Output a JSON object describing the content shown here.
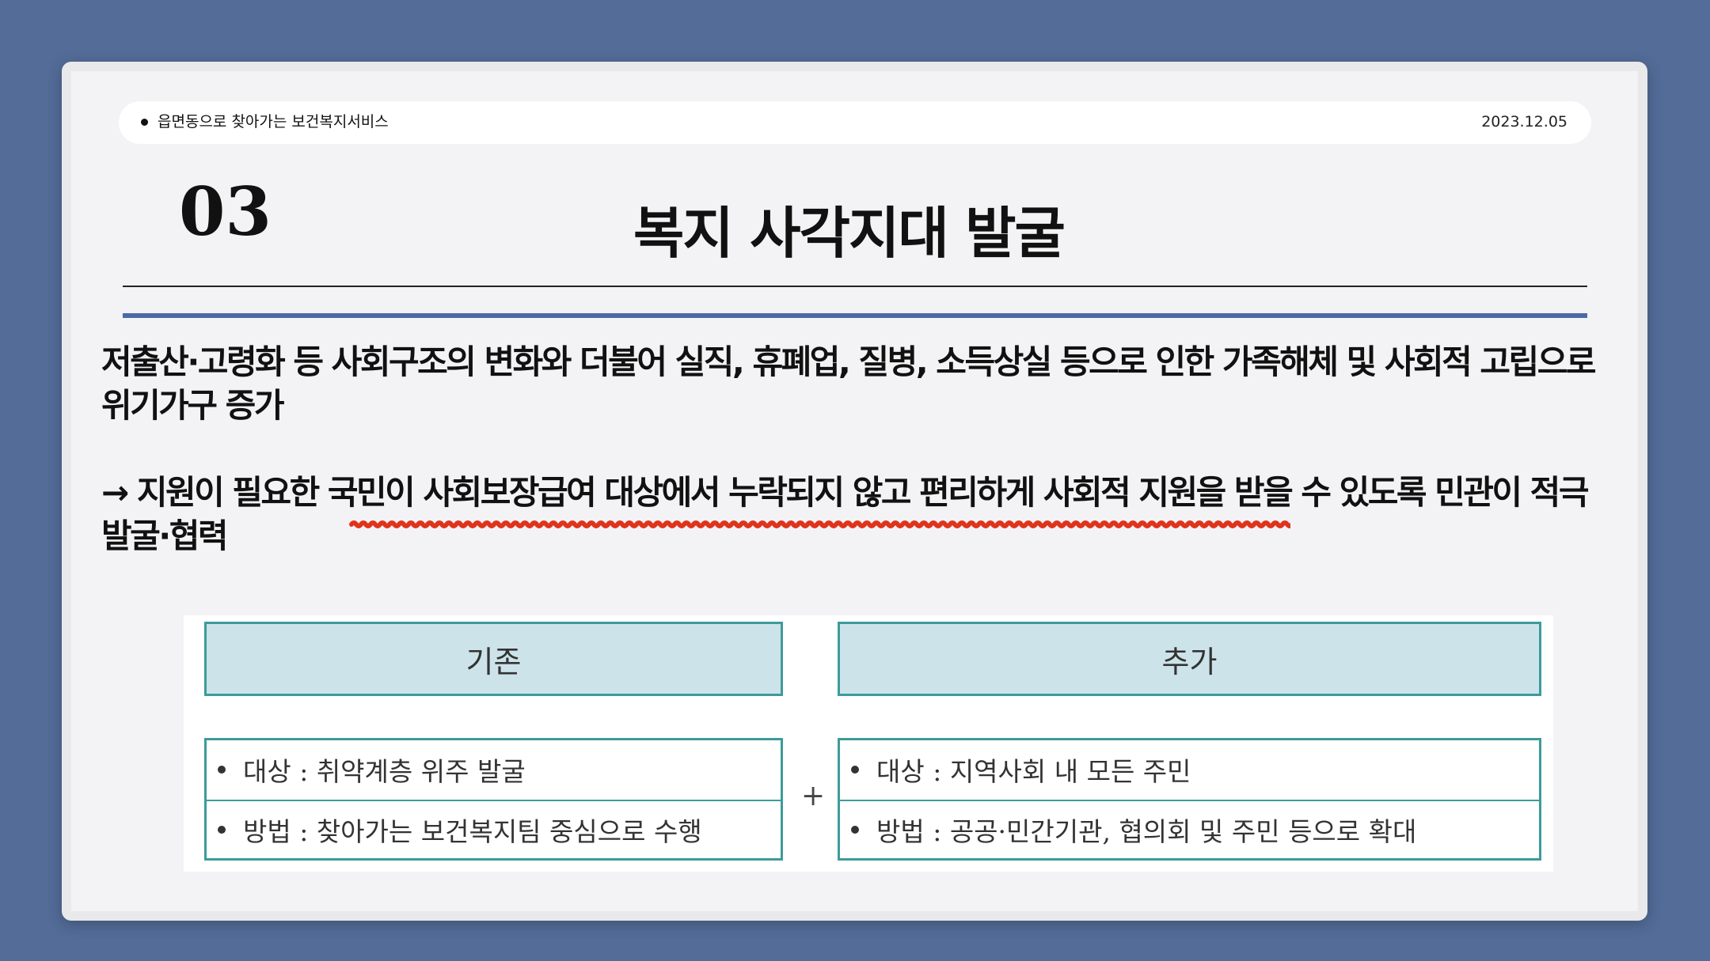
{
  "header": {
    "title": "읍면동으로 찾아가는 보건복지서비스",
    "date": "2023.12.05"
  },
  "section": {
    "number": "03",
    "title": "복지 사각지대 발굴"
  },
  "body": {
    "paragraph1": "저출산·고령화 등 사회구조의 변화와 더불어 실직, 휴폐업, 질병, 소득상실 등으로 인한 가족해체 및 사회적 고립으로 위기가구 증가",
    "paragraph2": "→ 지원이 필요한 국민이 사회보장급여 대상에서 누락되지 않고 편리하게 사회적 지원을 받을 수 있도록 민관이 적극 발굴·협력"
  },
  "colors": {
    "background": "#536c98",
    "accent_rule": "#4a6aa8",
    "underline": "#e0331c",
    "table_border": "#3d9b9b",
    "table_header_fill": "#cde3ea"
  },
  "comparison": {
    "left": {
      "header": "기존",
      "rows": [
        "대상 : 취약계층 위주 발굴",
        "방법 : 찾아가는 보건복지팀 중심으로 수행"
      ]
    },
    "operator": "+",
    "right": {
      "header": "추가",
      "rows": [
        "대상 : 지역사회 내 모든 주민",
        "방법 : 공공·민간기관, 협의회 및 주민 등으로 확대"
      ]
    }
  }
}
